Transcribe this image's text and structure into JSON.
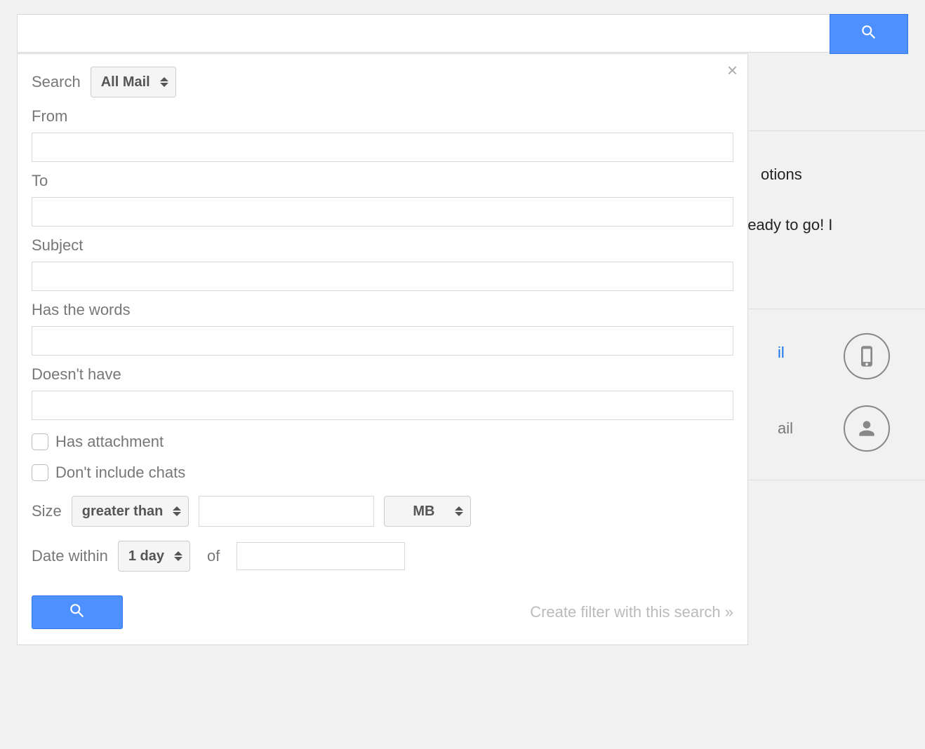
{
  "top_search": {
    "value": ""
  },
  "panel": {
    "search_label": "Search",
    "search_scope": "All Mail",
    "from_label": "From",
    "from_value": "",
    "to_label": "To",
    "to_value": "",
    "subject_label": "Subject",
    "subject_value": "",
    "has_words_label": "Has the words",
    "has_words_value": "",
    "doesnt_have_label": "Doesn't have",
    "doesnt_have_value": "",
    "has_attachment_label": "Has attachment",
    "dont_include_chats_label": "Don't include chats",
    "size_label": "Size",
    "size_comparator": "greater than",
    "size_value": "",
    "size_unit": "MB",
    "date_within_label": "Date within",
    "date_within_value": "1 day",
    "of_label": "of",
    "date_value": "",
    "create_filter_label": "Create filter with this search »"
  },
  "background": {
    "tab_label": "otions",
    "ready_text": "ready to go! I",
    "link1": "il",
    "link2": "ail"
  }
}
